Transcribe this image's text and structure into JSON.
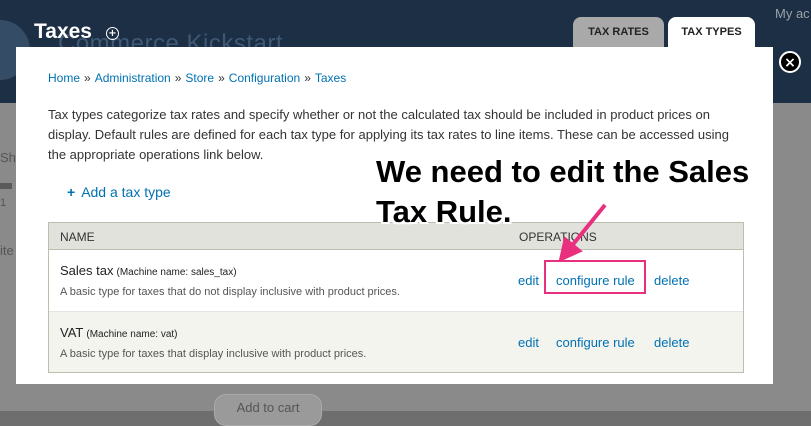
{
  "background": {
    "site_name": "Commerce Kickstart",
    "account_text": "My ac",
    "side_text_1": "Sh",
    "side_text_2": "1",
    "side_text_3": "ite",
    "cart_button": "Add to cart"
  },
  "overlay": {
    "title": "Taxes",
    "shortcut_icon": "+",
    "tabs": [
      {
        "label": "TAX RATES",
        "active": false
      },
      {
        "label": "TAX TYPES",
        "active": true
      }
    ],
    "close_icon": "×"
  },
  "breadcrumb": [
    "Home",
    "Administration",
    "Store",
    "Configuration",
    "Taxes"
  ],
  "breadcrumb_separator": "»",
  "intro_text": "Tax types categorize tax rates and specify whether or not the calculated tax should be included in product prices on display. Default rules are defined for each tax type for applying its tax rates to line items. These can be accessed using the appropriate operations link below.",
  "add_link": {
    "icon": "+",
    "label": "Add a tax type"
  },
  "table": {
    "headers": {
      "name": "NAME",
      "operations": "OPERATIONS"
    },
    "rows": [
      {
        "name": "Sales tax",
        "machine": "(Machine name: sales_tax)",
        "description": "A basic type for taxes that do not display inclusive with product prices.",
        "ops": [
          "edit",
          "configure rule",
          "delete"
        ]
      },
      {
        "name": "VAT",
        "machine": "(Machine name: vat)",
        "description": "A basic type for taxes that display inclusive with product prices.",
        "ops": [
          "edit",
          "configure rule",
          "delete"
        ]
      }
    ]
  },
  "annotation": {
    "line1": "We need to edit the Sales",
    "line2": "Tax Rule."
  },
  "colors": {
    "link": "#0071b3",
    "highlight": "#e8307e",
    "header_bg": "#1d2f45"
  }
}
